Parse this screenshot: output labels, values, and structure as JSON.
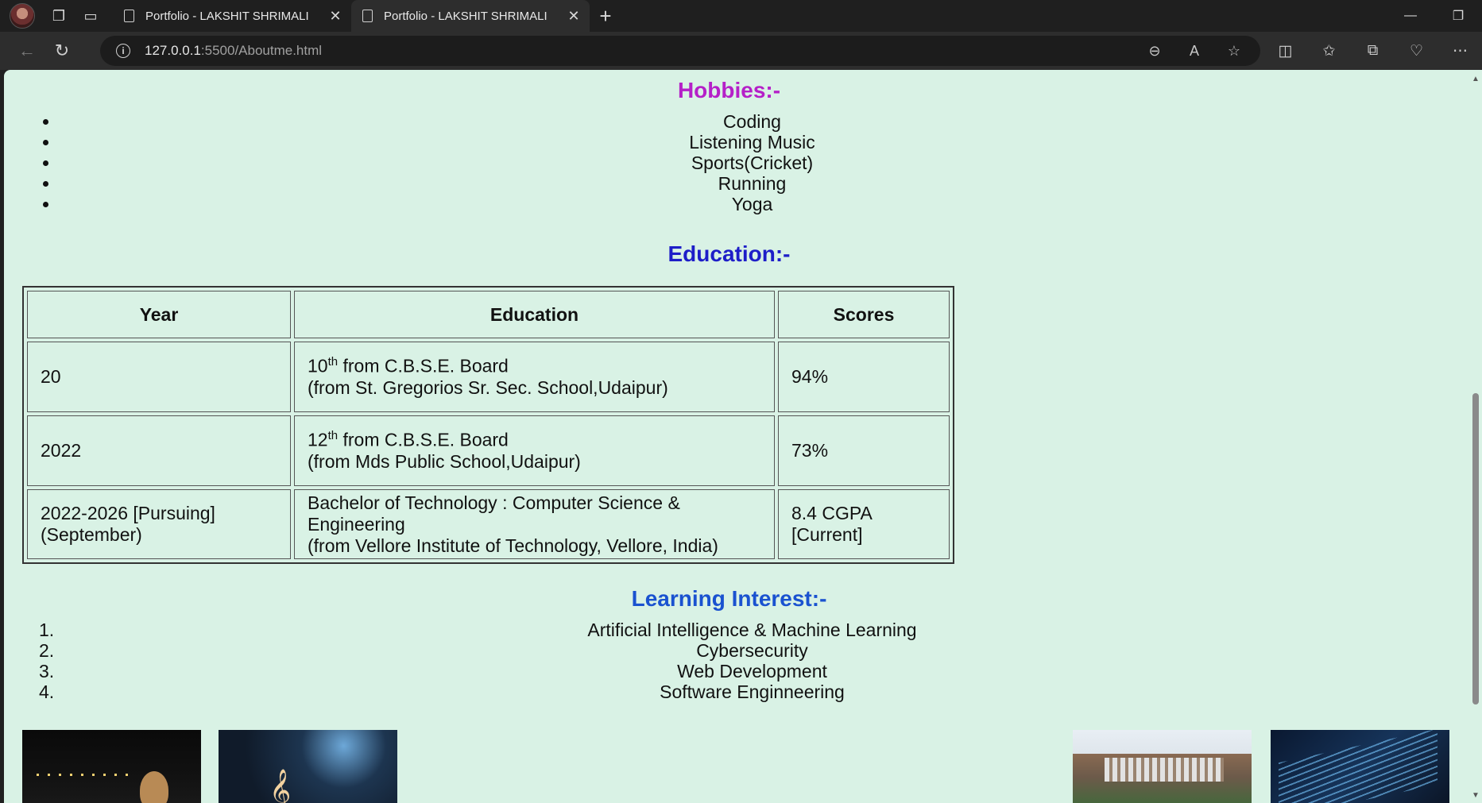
{
  "browser": {
    "tabs": [
      {
        "title": "Portfolio - LAKSHIT SHRIMALI",
        "active": false
      },
      {
        "title": "Portfolio - LAKSHIT SHRIMALI",
        "active": true
      }
    ],
    "url_host": "127.0.0.1",
    "url_rest": ":5500/Aboutme.html"
  },
  "page": {
    "hobbies_title": "Hobbies:-",
    "hobbies": [
      "Coding",
      "Listening Music",
      "Sports(Cricket)",
      "Running",
      "Yoga"
    ],
    "education_title": "Education:-",
    "education_table": {
      "headers": [
        "Year",
        "Education",
        "Scores"
      ],
      "rows": [
        {
          "year": "20",
          "edu_prefix": "10",
          "edu_sup": "th",
          "edu_line1": " from C.B.S.E. Board",
          "edu_line2": "(from St. Gregorios Sr. Sec. School,Udaipur)",
          "score": "94%"
        },
        {
          "year": "2022",
          "edu_prefix": "12",
          "edu_sup": "th",
          "edu_line1": " from C.B.S.E. Board",
          "edu_line2": "(from Mds Public School,Udaipur)",
          "score": "73%"
        },
        {
          "year": "2022-2026 [Pursuing](September)",
          "edu_line1": "Bachelor of Technology : Computer Science & Engineering",
          "edu_line2": "(from Vellore Institute of Technology, Vellore, India)",
          "score": "8.4 CGPA [Current]"
        }
      ]
    },
    "learning_title": "Learning Interest:-",
    "learning": [
      "Artificial Intelligence & Machine Learning",
      "Cybersecurity",
      "Web Development",
      "Software Enginneering"
    ],
    "learning_numbers": [
      "1.",
      "2.",
      "3.",
      "4."
    ]
  },
  "colors": {
    "page_bg": "#d9f2e5",
    "hobbies_heading": "#b520c8",
    "education_heading": "#1e1ec8",
    "learning_heading": "#1a52d0"
  }
}
